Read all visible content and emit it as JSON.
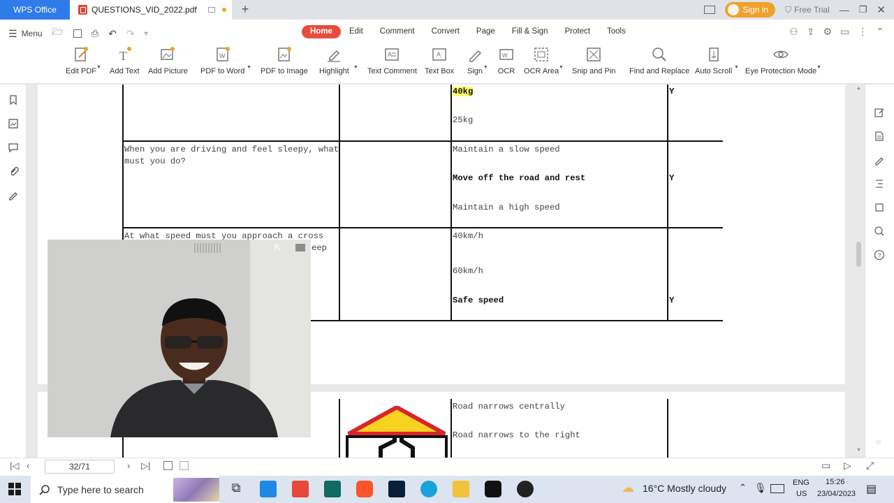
{
  "titlebar": {
    "app_tab": "WPS Office",
    "doc_tab": "QUESTIONS_VID_2022.pdf",
    "new_tab": "+",
    "sign_in": "Sign in",
    "free_trial": "Free Trial"
  },
  "menubar": {
    "menu_label": "Menu",
    "tabs": [
      "Home",
      "Edit",
      "Comment",
      "Convert",
      "Page",
      "Fill & Sign",
      "Protect",
      "Tools"
    ]
  },
  "ribbon": {
    "buttons": [
      {
        "label": "Edit PDF",
        "icon": "edit-pdf-icon"
      },
      {
        "label": "Add Text",
        "icon": "add-text-icon"
      },
      {
        "label": "Add Picture",
        "icon": "add-picture-icon"
      },
      {
        "label": "PDF to Word",
        "icon": "pdf-to-word-icon"
      },
      {
        "label": "PDF to Image",
        "icon": "pdf-to-image-icon"
      },
      {
        "label": "Highlight",
        "icon": "highlight-icon"
      },
      {
        "label": "Text Comment",
        "icon": "text-comment-icon"
      },
      {
        "label": "Text Box",
        "icon": "text-box-icon"
      },
      {
        "label": "Sign",
        "icon": "sign-icon"
      },
      {
        "label": "OCR",
        "icon": "ocr-icon"
      },
      {
        "label": "OCR Area",
        "icon": "ocr-area-icon"
      },
      {
        "label": "Snip and Pin",
        "icon": "snip-and-pin-icon"
      },
      {
        "label": "Find and Replace",
        "icon": "find-replace-icon"
      },
      {
        "label": "Auto Scroll",
        "icon": "auto-scroll-icon"
      },
      {
        "label": "Eye Protection Mode",
        "icon": "eye-protection-icon"
      }
    ]
  },
  "document": {
    "row1": {
      "options": [
        "40kg",
        "25kg"
      ],
      "answer": "Y"
    },
    "row2": {
      "question_line1": "When you are driving and feel sleepy, what",
      "question_line2": "must you do?",
      "options": [
        "Maintain a slow speed",
        "Move off the road and rest",
        "Maintain a high speed"
      ],
      "answer": "Y"
    },
    "row3": {
      "question_line1": "At what speed must you approach a cross",
      "question_partial": "eep",
      "options": [
        "40km/h",
        "60km/h",
        "Safe speed"
      ],
      "answer": "Y"
    },
    "row4": {
      "options": [
        "Road narrows centrally",
        "Road narrows to the right"
      ]
    }
  },
  "statusbar": {
    "page_indicator": "32/71"
  },
  "taskbar": {
    "search_placeholder": "Type here to search",
    "weather": "16°C  Mostly cloudy",
    "lang_top": "ENG",
    "lang_bottom": "US",
    "time": "15:26",
    "date": "23/04/2023"
  }
}
